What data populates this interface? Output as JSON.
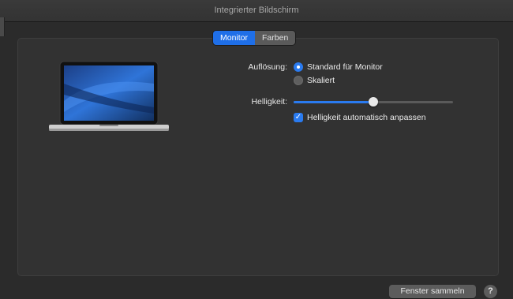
{
  "window": {
    "title": "Integrierter Bildschirm"
  },
  "tabs": [
    {
      "label": "Monitor",
      "active": true
    },
    {
      "label": "Farben",
      "active": false
    }
  ],
  "display_icon": "laptop-display-icon",
  "resolution": {
    "label": "Auflösung:",
    "options": [
      {
        "label": "Standard für Monitor",
        "selected": true
      },
      {
        "label": "Skaliert",
        "selected": false
      }
    ]
  },
  "brightness": {
    "label": "Helligkeit:",
    "level": 0.5,
    "auto_label": "Helligkeit automatisch anpassen",
    "auto_checked": true
  },
  "footer": {
    "gather_button": "Fenster sammeln",
    "help": "?"
  },
  "colors": {
    "accent": "#2a7bf0",
    "background": "#2b2b2b"
  }
}
